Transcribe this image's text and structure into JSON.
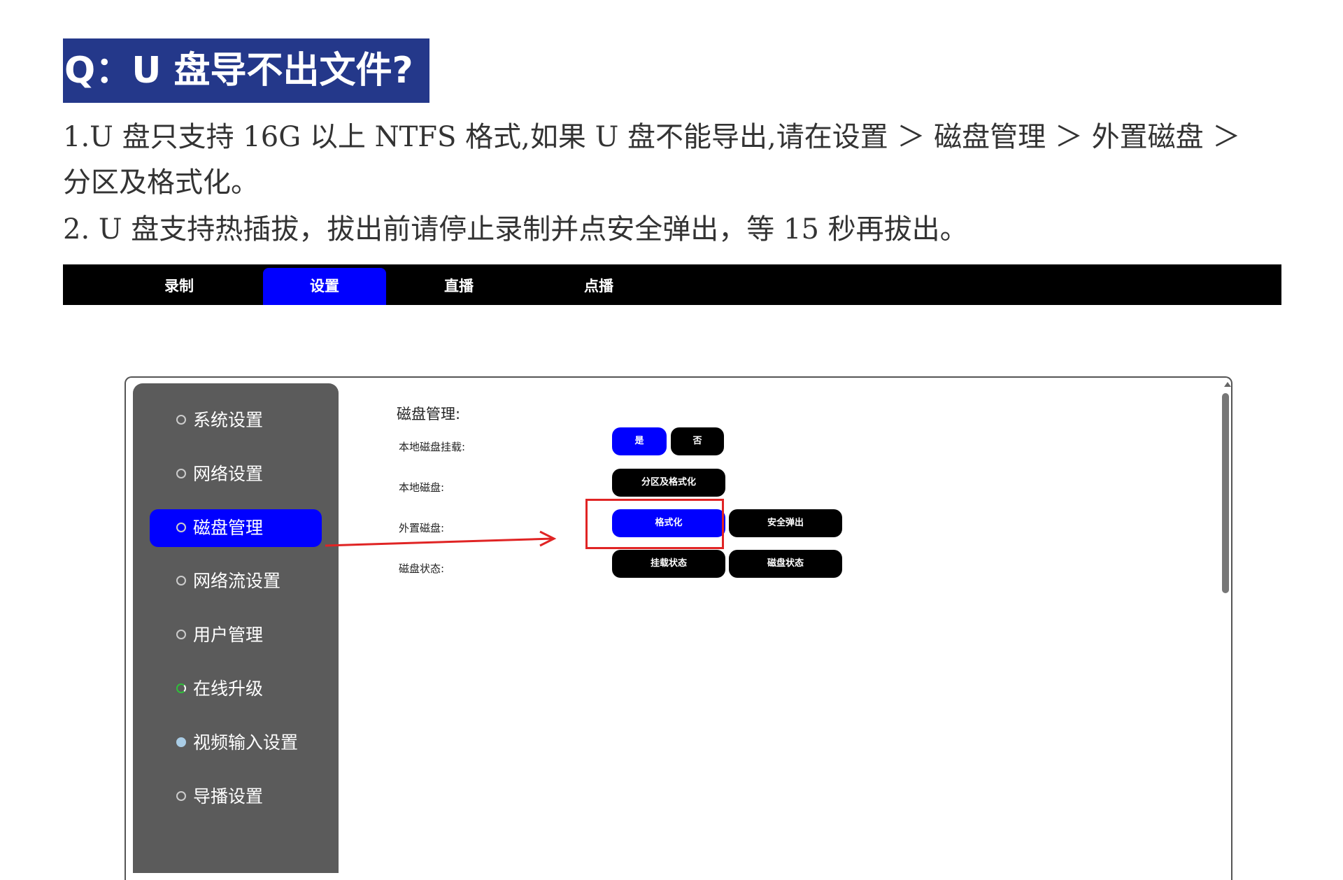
{
  "heading": "Q：U 盘导不出文件?",
  "paragraphs": [
    "1.U 盘只支持 16G 以上 NTFS 格式,如果 U 盘不能导出,请在设置 ＞ 磁盘管理 ＞ 外置磁盘 ＞",
    "分区及格式化。",
    "2. U 盘支持热插拔，拔出前请停止录制并点安全弹出，等 15 秒再拔出。"
  ],
  "topnav": {
    "tabs": [
      "录制",
      "设置",
      "直播",
      "点播"
    ],
    "active": "设置"
  },
  "sidebar": {
    "items": [
      {
        "label": "系统设置",
        "icon": "gear-icon"
      },
      {
        "label": "网络设置",
        "icon": "gear-icon"
      },
      {
        "label": "磁盘管理",
        "icon": "gear-icon",
        "active": true
      },
      {
        "label": "网络流设置",
        "icon": "gear-icon"
      },
      {
        "label": "用户管理",
        "icon": "gear-icon"
      },
      {
        "label": "在线升级",
        "icon": "refresh-icon"
      },
      {
        "label": "视频输入设置",
        "icon": "video-icon"
      },
      {
        "label": "导播设置",
        "icon": "gear-icon"
      }
    ]
  },
  "content": {
    "title": "磁盘管理:",
    "rows": [
      {
        "label": "本地磁盘挂载:",
        "buttons": [
          "是",
          "否"
        ]
      },
      {
        "label": "本地磁盘:",
        "buttons": [
          "分区及格式化"
        ]
      },
      {
        "label": "外置磁盘:",
        "buttons": [
          "格式化",
          "安全弹出"
        ]
      },
      {
        "label": "磁盘状态:",
        "buttons": [
          "挂载状态",
          "磁盘状态"
        ]
      }
    ]
  },
  "colors": {
    "heading_bg": "#24388a",
    "active_blue": "#0000ff",
    "sidebar_bg": "#5b5b5b",
    "annotation_red": "#e02424"
  }
}
